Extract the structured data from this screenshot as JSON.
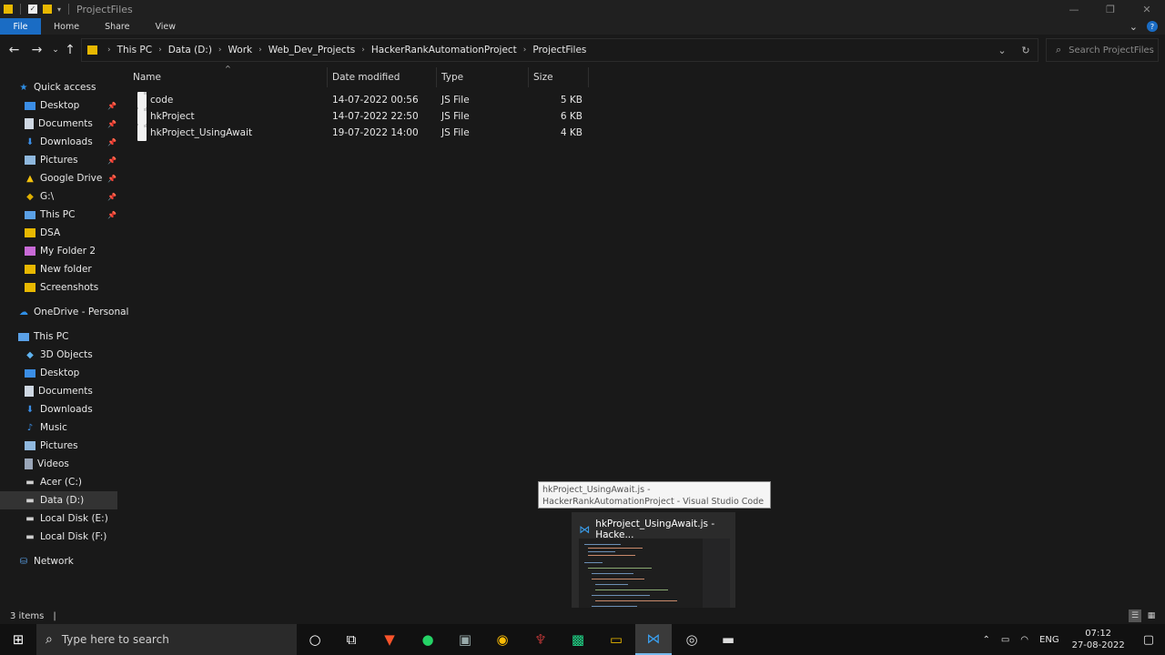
{
  "window": {
    "title": "ProjectFiles",
    "controls": [
      "—",
      "❐",
      "✕"
    ]
  },
  "ribbon": {
    "tabs": [
      "File",
      "Home",
      "Share",
      "View"
    ]
  },
  "address": {
    "crumbs": [
      "This PC",
      "Data (D:)",
      "Work",
      "Web_Dev_Projects",
      "HackerRankAutomationProject",
      "ProjectFiles"
    ],
    "search_placeholder": "Search ProjectFiles"
  },
  "nav": {
    "quick_access": "Quick access",
    "quick_items": [
      {
        "label": "Desktop",
        "icon": "desktop-icon",
        "pinned": true
      },
      {
        "label": "Documents",
        "icon": "documents-icon",
        "pinned": true
      },
      {
        "label": "Downloads",
        "icon": "downloads-icon",
        "pinned": true
      },
      {
        "label": "Pictures",
        "icon": "pictures-icon",
        "pinned": true
      },
      {
        "label": "Google Drive",
        "icon": "google-drive-icon",
        "pinned": true
      },
      {
        "label": "G:\\",
        "icon": "drive-icon",
        "pinned": true
      },
      {
        "label": "This PC",
        "icon": "this-pc-icon",
        "pinned": true
      },
      {
        "label": "DSA",
        "icon": "folder-icon",
        "pinned": false
      },
      {
        "label": "My Folder 2",
        "icon": "folder-icon",
        "pinned": false
      },
      {
        "label": "New folder",
        "icon": "folder-icon",
        "pinned": false
      },
      {
        "label": "Screenshots",
        "icon": "folder-icon",
        "pinned": false
      }
    ],
    "onedrive": "OneDrive - Personal",
    "this_pc": "This PC",
    "pc_items": [
      {
        "label": "3D Objects",
        "icon": "3d-objects-icon"
      },
      {
        "label": "Desktop",
        "icon": "desktop-icon"
      },
      {
        "label": "Documents",
        "icon": "documents-icon"
      },
      {
        "label": "Downloads",
        "icon": "downloads-icon"
      },
      {
        "label": "Music",
        "icon": "music-icon"
      },
      {
        "label": "Pictures",
        "icon": "pictures-icon"
      },
      {
        "label": "Videos",
        "icon": "videos-icon"
      },
      {
        "label": "Acer (C:)",
        "icon": "drive-icon"
      },
      {
        "label": "Data (D:)",
        "icon": "drive-icon",
        "selected": true
      },
      {
        "label": "Local Disk (E:)",
        "icon": "drive-icon"
      },
      {
        "label": "Local Disk (F:)",
        "icon": "drive-icon"
      }
    ],
    "network": "Network"
  },
  "columns": {
    "name": "Name",
    "date": "Date modified",
    "type": "Type",
    "size": "Size"
  },
  "files": [
    {
      "name": "code",
      "date": "14-07-2022 00:56",
      "type": "JS File",
      "size": "5 KB"
    },
    {
      "name": "hkProject",
      "date": "14-07-2022 22:50",
      "type": "JS File",
      "size": "6 KB"
    },
    {
      "name": "hkProject_UsingAwait",
      "date": "19-07-2022 14:00",
      "type": "JS File",
      "size": "4 KB"
    }
  ],
  "status": {
    "items": "3 items",
    "cursor": "|"
  },
  "tooltip": {
    "text": "hkProject_UsingAwait.js - HackerRankAutomationProject - Visual Studio Code"
  },
  "thumbnail": {
    "title": "hkProject_UsingAwait.js - Hacke..."
  },
  "taskbar": {
    "search_placeholder": "Type here to search",
    "tray_lang": "ENG",
    "time": "07:12",
    "date": "27-08-2022"
  },
  "colors": {
    "accent": "#1a6cc4",
    "selected_bg": "#333333",
    "taskbar_active": "#76b9ed"
  }
}
